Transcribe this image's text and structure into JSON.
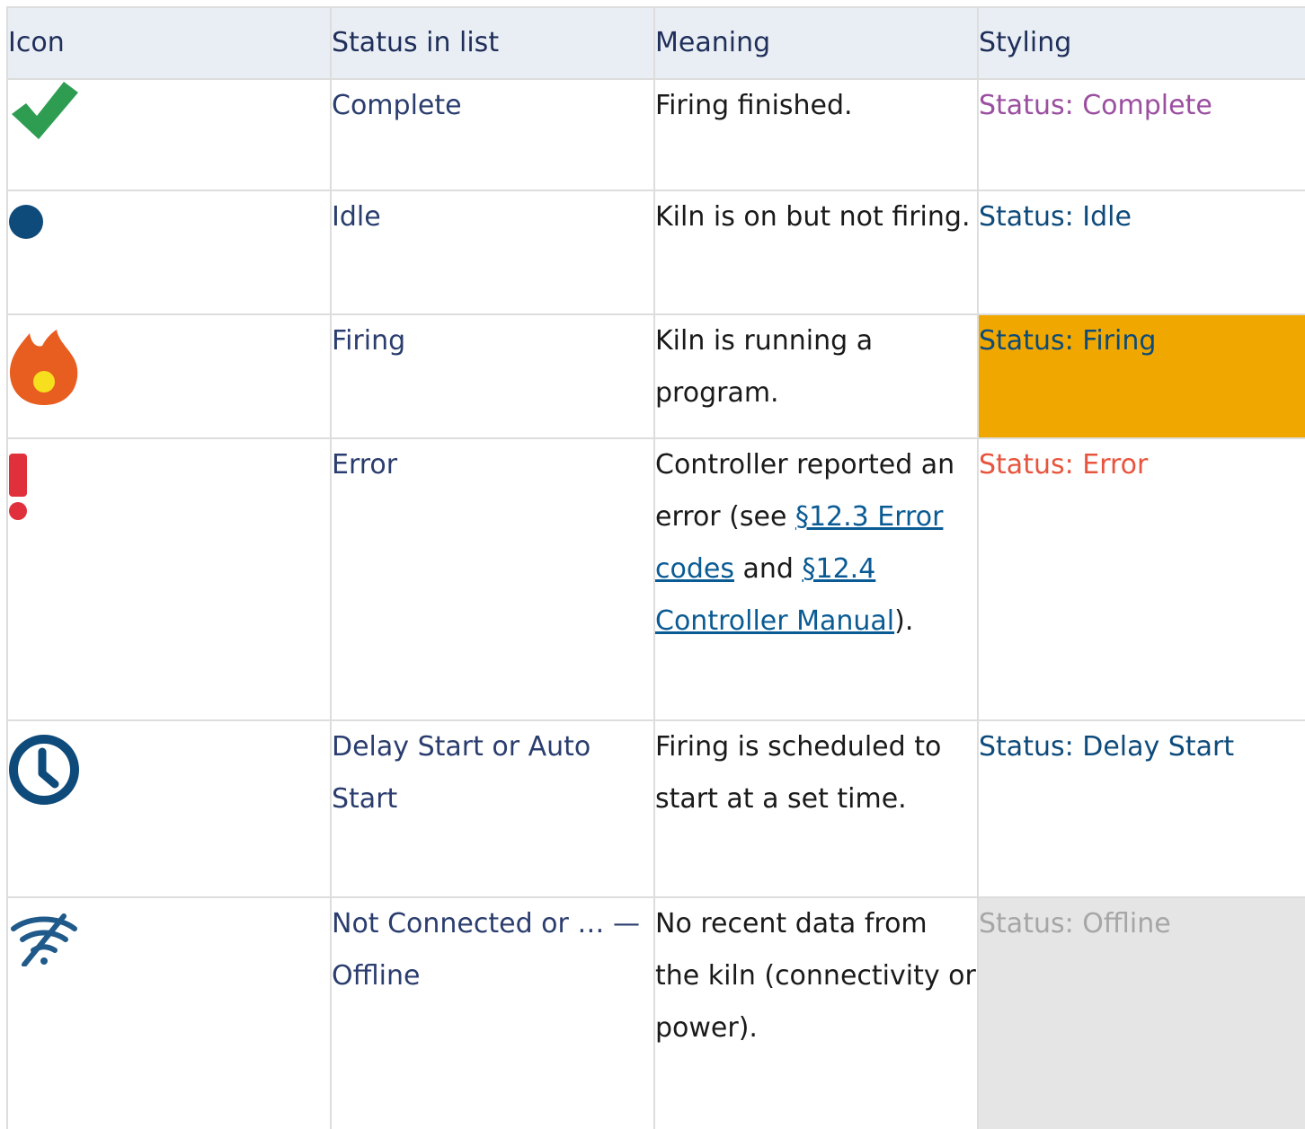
{
  "table": {
    "headers": {
      "icon": "Icon",
      "status": "Status in list",
      "meaning": "Meaning",
      "styling": "Styling"
    },
    "rows": [
      {
        "icon": "checkmark-icon",
        "icon_color": "#2e9d52",
        "status": "Complete",
        "meaning": "Firing finished.",
        "styling": "Status: Complete",
        "styling_color": "#9b4fa0"
      },
      {
        "icon": "dot-icon",
        "icon_color": "#0e4a7a",
        "status": "Idle",
        "meaning": "Kiln is on but not firing.",
        "styling": "Status: Idle",
        "styling_color": "#0e4a7a"
      },
      {
        "icon": "flame-icon",
        "icon_color": "#e85d20",
        "status": "Firing",
        "meaning": "Kiln is running a program.",
        "styling": "Status: Firing",
        "styling_color": "#0e4a7a",
        "styling_background": "#f0a800"
      },
      {
        "icon": "exclamation-icon",
        "icon_color": "#e0303c",
        "status": "Error",
        "meaning_prefix": "Controller reported an error (see ",
        "meaning_link1": "§12.3 Error codes",
        "meaning_mid": " and ",
        "meaning_link2": "§12.4 Controller Manual",
        "meaning_suffix": ").",
        "styling": "Status: Error",
        "styling_color": "#e8553e"
      },
      {
        "icon": "clock-icon",
        "icon_color": "#0e4a7a",
        "status_a": "Delay Start",
        "status_or": " or ",
        "status_b": "Auto Start",
        "meaning": "Firing is scheduled to start at a set time.",
        "styling": "Status: Delay Start",
        "styling_color": "#0e4a7a"
      },
      {
        "icon": "wifi-off-icon",
        "icon_color": "#1f5a8a",
        "status_a": "Not Connected",
        "status_or": " or … ",
        "status_b": "— Offline",
        "meaning": "No recent data from the kiln (connectivity or power).",
        "styling": "Status: Offline",
        "styling_color": "#a6a6a6",
        "styling_background": "#e5e5e5"
      }
    ]
  }
}
